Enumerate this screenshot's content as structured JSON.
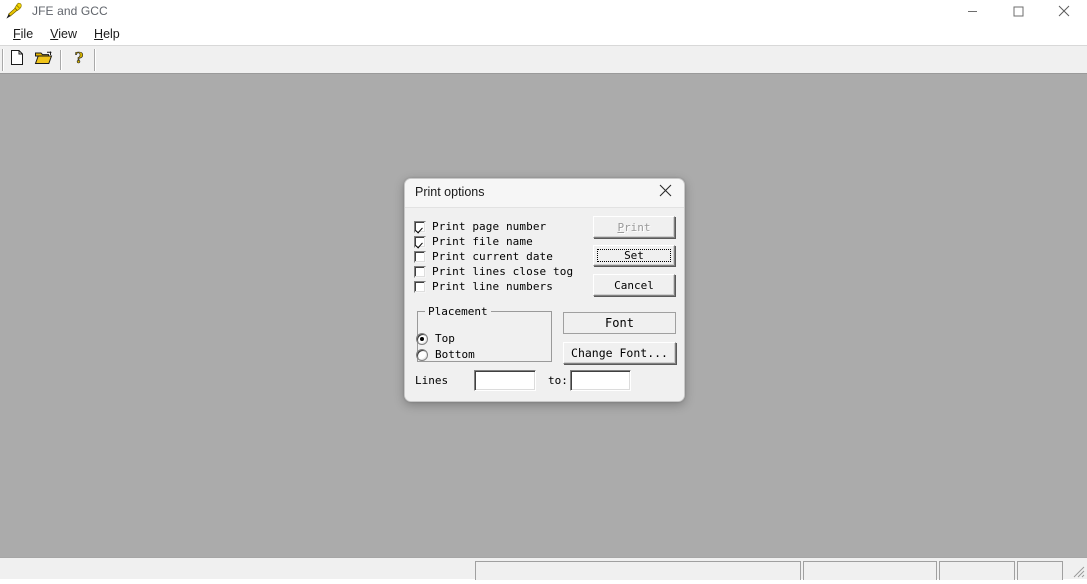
{
  "window": {
    "title": "JFE and GCC",
    "icon": "quill-pen-icon",
    "controls": {
      "minimize": "minimize-icon",
      "maximize": "maximize-icon",
      "close": "close-icon"
    }
  },
  "menubar": {
    "items": [
      {
        "label": "File",
        "mnemonic": "F",
        "rest": "ile"
      },
      {
        "label": "View",
        "mnemonic": "V",
        "rest": "iew"
      },
      {
        "label": "Help",
        "mnemonic": "H",
        "rest": "elp"
      }
    ]
  },
  "toolbar": {
    "buttons": [
      {
        "name": "new-file-icon",
        "tooltip": "New"
      },
      {
        "name": "open-file-icon",
        "tooltip": "Open"
      },
      {
        "name": "help-icon",
        "tooltip": "Help"
      }
    ]
  },
  "statusbar": {
    "panels": [
      "",
      "",
      "",
      ""
    ]
  },
  "dialog": {
    "title": "Print options",
    "close_icon": "close-icon",
    "checkboxes": [
      {
        "label": "Print page number",
        "checked": true
      },
      {
        "label": "Print file name",
        "checked": true
      },
      {
        "label": "Print current date",
        "checked": false
      },
      {
        "label": "Print lines close tog",
        "checked": false
      },
      {
        "label": "Print line numbers",
        "checked": false
      }
    ],
    "buttons": {
      "print": {
        "label": "Print",
        "mnemonic": "P",
        "rest": "rint",
        "disabled": true
      },
      "set": {
        "label": "Set",
        "focused": true
      },
      "cancel": {
        "label": "Cancel"
      },
      "change_font": {
        "label": "Change Font..."
      }
    },
    "font_display": {
      "label": "Font"
    },
    "placement": {
      "legend": "Placement",
      "options": [
        {
          "label": "Top",
          "selected": true
        },
        {
          "label": "Bottom",
          "selected": false
        }
      ]
    },
    "lines": {
      "label": "Lines",
      "from_value": "",
      "to_label": "to:",
      "to_value": ""
    }
  },
  "colors": {
    "client_background": "#ababab",
    "dialog_background": "#f0f0f0",
    "toolbar_background": "#f0f0f0",
    "titlebar_background": "#ffffff",
    "title_text": "#60646b",
    "folder_icon": "#d8a800"
  }
}
